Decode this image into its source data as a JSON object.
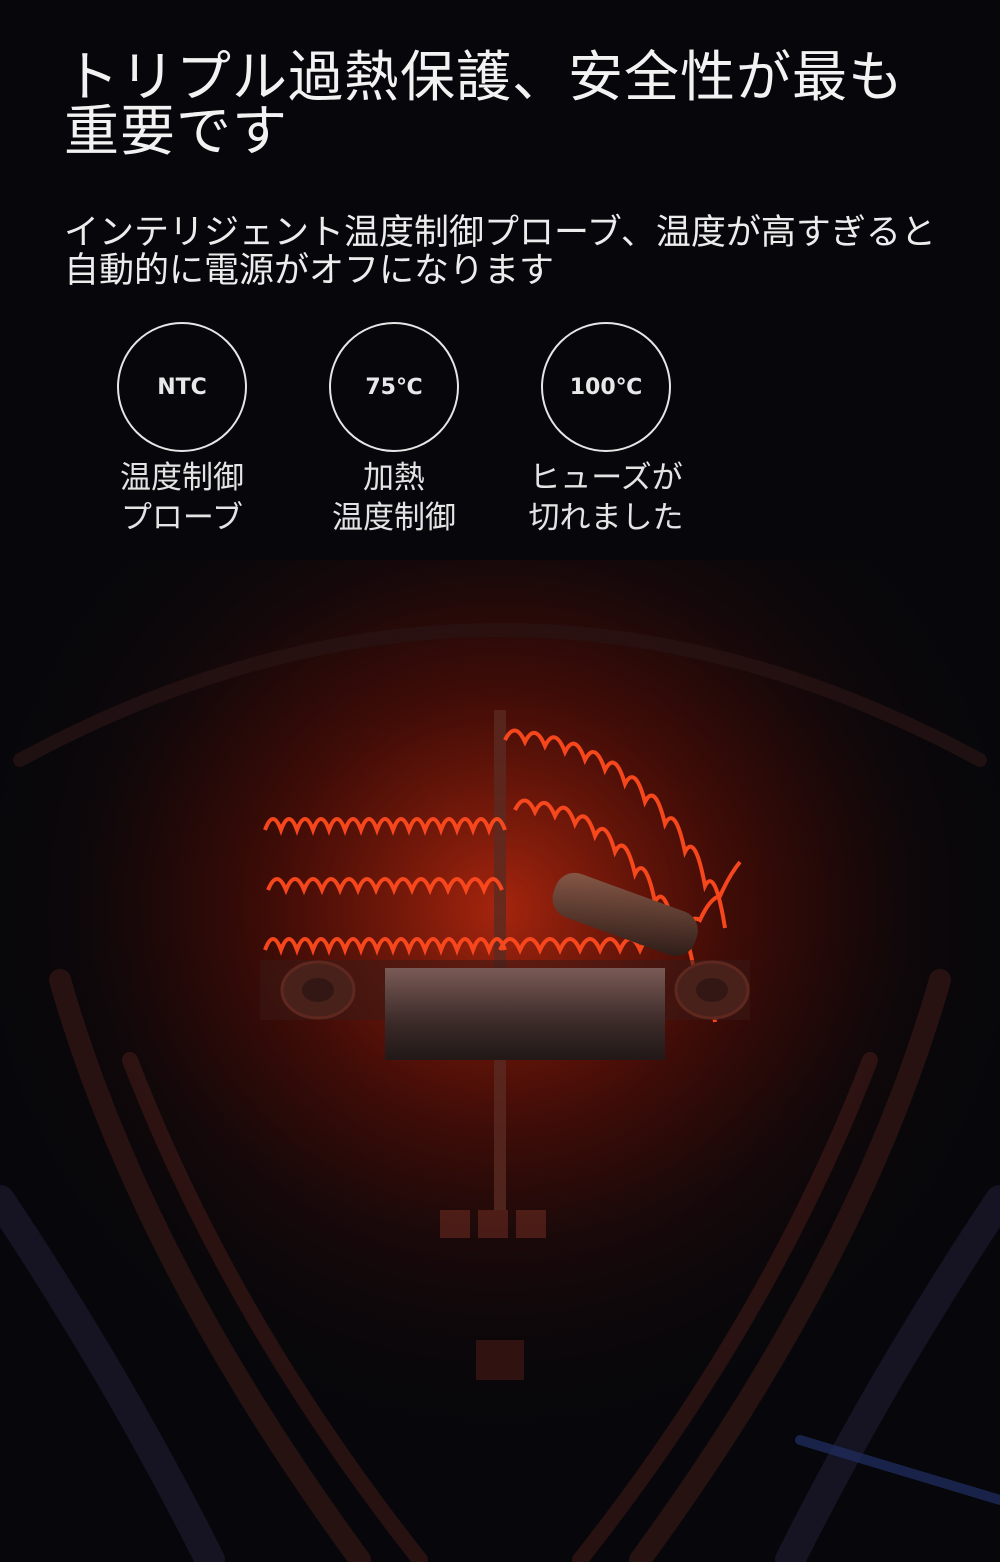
{
  "headline": "トリプル過熱保護、安全性が最も重要です",
  "subtitle": "インテリジェント温度制御プローブ、温度が高すぎると自動的に電源がオフになります",
  "features": [
    {
      "badge": "NTC",
      "caption_line1": "温度制御",
      "caption_line2": "プローブ"
    },
    {
      "badge": "75℃",
      "caption_line1": "加熱",
      "caption_line2": "温度制御"
    },
    {
      "badge": "100℃",
      "caption_line1": "ヒューズが",
      "caption_line2": "切れました"
    }
  ],
  "colors": {
    "background": "#050507",
    "coil_glow": "#ff3a14",
    "text": "#ffffff"
  }
}
